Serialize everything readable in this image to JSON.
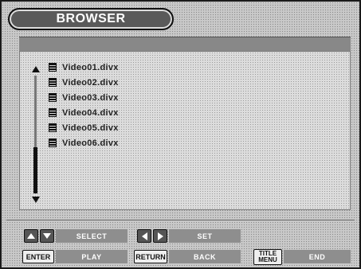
{
  "header": {
    "title": "BROWSER"
  },
  "files": [
    {
      "name": "Video01.divx",
      "icon": "film-icon"
    },
    {
      "name": "Video02.divx",
      "icon": "film-icon"
    },
    {
      "name": "Video03.divx",
      "icon": "film-icon"
    },
    {
      "name": "Video04.divx",
      "icon": "film-icon"
    },
    {
      "name": "Video05.divx",
      "icon": "film-icon"
    },
    {
      "name": "Video06.divx",
      "icon": "film-icon"
    }
  ],
  "footer": {
    "row1": {
      "select_label": "SELECT",
      "set_label": "SET"
    },
    "row2": {
      "enter_key": "ENTER",
      "play_label": "PLAY",
      "return_key": "RETURN",
      "back_label": "BACK",
      "title_menu_line1": "TITLE",
      "title_menu_line2": "MENU",
      "end_label": "END"
    }
  }
}
